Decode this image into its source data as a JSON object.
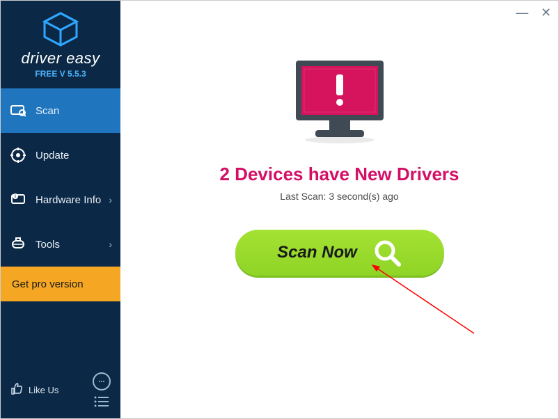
{
  "window": {
    "minimize": "—",
    "close": "✕"
  },
  "brand": {
    "name": "driver easy",
    "version": "FREE V 5.5.3"
  },
  "sidebar": {
    "items": [
      {
        "label": "Scan",
        "icon": "scan-icon",
        "chevron": false,
        "active": true
      },
      {
        "label": "Update",
        "icon": "update-icon",
        "chevron": false,
        "active": false
      },
      {
        "label": "Hardware Info",
        "icon": "hardware-icon",
        "chevron": true,
        "active": false
      },
      {
        "label": "Tools",
        "icon": "tools-icon",
        "chevron": true,
        "active": false
      }
    ],
    "pro_label": "Get pro version",
    "like_label": "Like Us"
  },
  "main": {
    "headline": "2 Devices have New Drivers",
    "last_scan": "Last Scan: 3 second(s) ago",
    "scan_button": "Scan Now"
  },
  "colors": {
    "accent_pink": "#d31066",
    "sidebar_bg": "#0b2946",
    "active_nav": "#1f76bf",
    "pro_bg": "#f5a623",
    "scan_green": "#8fd426"
  }
}
